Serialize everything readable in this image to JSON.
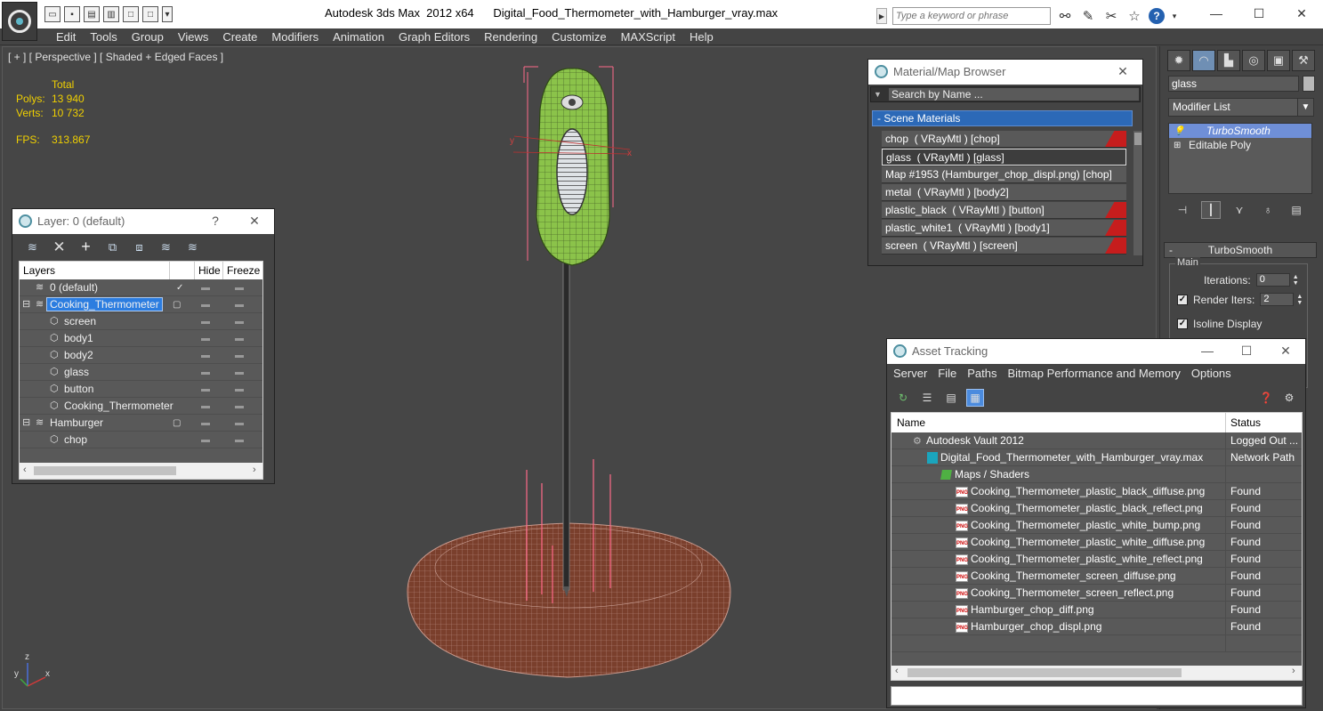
{
  "titlebar": {
    "app": "Autodesk 3ds Max  2012 x64",
    "file": "Digital_Food_Thermometer_with_Hamburger_vray.max",
    "search_placeholder": "Type a keyword or phrase",
    "minimize": "—",
    "maximize": "☐",
    "close": "✕"
  },
  "menus": [
    "Edit",
    "Tools",
    "Group",
    "Views",
    "Create",
    "Modifiers",
    "Animation",
    "Graph Editors",
    "Rendering",
    "Customize",
    "MAXScript",
    "Help"
  ],
  "viewport": {
    "label": "[ + ] [ Perspective ] [ Shaded + Edged Faces ]",
    "stats": {
      "total_label": "Total",
      "polys_label": "Polys:",
      "polys_value": "13 940",
      "verts_label": "Verts:",
      "verts_value": "10 732",
      "fps_label": "FPS:",
      "fps_value": "313.867"
    },
    "axis": {
      "x": "x",
      "y": "y",
      "z": "z"
    }
  },
  "layer_window": {
    "title": "Layer: 0 (default)",
    "help": "?",
    "close": "✕",
    "columns": {
      "layers": "Layers",
      "hide": "Hide",
      "freeze": "Freeze"
    },
    "rows": [
      {
        "name": "0 (default)",
        "level": 0,
        "kind": "layer",
        "active": true
      },
      {
        "name": "Cooking_Thermometer",
        "level": 0,
        "kind": "layer",
        "selected": true
      },
      {
        "name": "screen",
        "level": 1,
        "kind": "object"
      },
      {
        "name": "body1",
        "level": 1,
        "kind": "object"
      },
      {
        "name": "body2",
        "level": 1,
        "kind": "object"
      },
      {
        "name": "glass",
        "level": 1,
        "kind": "object"
      },
      {
        "name": "button",
        "level": 1,
        "kind": "object"
      },
      {
        "name": "Cooking_Thermometer",
        "level": 1,
        "kind": "object"
      },
      {
        "name": "Hamburger",
        "level": 0,
        "kind": "layer"
      },
      {
        "name": "chop",
        "level": 1,
        "kind": "object"
      }
    ]
  },
  "material_browser": {
    "title": "Material/Map Browser",
    "close": "✕",
    "search_placeholder": "Search by Name ...",
    "group_label": "- Scene Materials",
    "items": [
      {
        "label": "chop  ( VRayMtl ) [chop]",
        "swatch": true
      },
      {
        "label": "glass  ( VRayMtl ) [glass]",
        "swatch": false,
        "selected": true
      },
      {
        "label": "Map #1953 (Hamburger_chop_displ.png) [chop]",
        "swatch": false
      },
      {
        "label": "metal  ( VRayMtl ) [body2]",
        "swatch": false
      },
      {
        "label": "plastic_black  ( VRayMtl ) [button]",
        "swatch": true
      },
      {
        "label": "plastic_white1  ( VRayMtl ) [body1]",
        "swatch": true
      },
      {
        "label": "screen  ( VRayMtl ) [screen]",
        "swatch": true
      }
    ]
  },
  "command_panel": {
    "object_name": "glass",
    "modifier_list": "Modifier List",
    "stack": [
      {
        "label": "TurboSmooth",
        "selected": true
      },
      {
        "label": "Editable Poly",
        "selected": false
      }
    ],
    "rollout_title": "TurboSmooth",
    "rollout_group": "Main",
    "iterations_label": "Iterations:",
    "iterations_value": "0",
    "render_iters_label": "Render Iters:",
    "render_iters_value": "2",
    "isoline_label": "Isoline Display"
  },
  "asset_tracking": {
    "title": "Asset Tracking",
    "menu": [
      "Server",
      "File",
      "Paths",
      "Bitmap Performance and Memory",
      "Options"
    ],
    "columns": {
      "name": "Name",
      "status": "Status"
    },
    "rows": [
      {
        "name": "Autodesk Vault 2012",
        "status": "Logged Out ...",
        "indent": 1,
        "icon": "vault"
      },
      {
        "name": "Digital_Food_Thermometer_with_Hamburger_vray.max",
        "status": "Network Path",
        "indent": 2,
        "icon": "max"
      },
      {
        "name": "Maps / Shaders",
        "status": "",
        "indent": 3,
        "icon": "maps"
      },
      {
        "name": "Cooking_Thermometer_plastic_black_diffuse.png",
        "status": "Found",
        "indent": 4,
        "icon": "png"
      },
      {
        "name": "Cooking_Thermometer_plastic_black_reflect.png",
        "status": "Found",
        "indent": 4,
        "icon": "png"
      },
      {
        "name": "Cooking_Thermometer_plastic_white_bump.png",
        "status": "Found",
        "indent": 4,
        "icon": "png"
      },
      {
        "name": "Cooking_Thermometer_plastic_white_diffuse.png",
        "status": "Found",
        "indent": 4,
        "icon": "png"
      },
      {
        "name": "Cooking_Thermometer_plastic_white_reflect.png",
        "status": "Found",
        "indent": 4,
        "icon": "png"
      },
      {
        "name": "Cooking_Thermometer_screen_diffuse.png",
        "status": "Found",
        "indent": 4,
        "icon": "png"
      },
      {
        "name": "Cooking_Thermometer_screen_reflect.png",
        "status": "Found",
        "indent": 4,
        "icon": "png"
      },
      {
        "name": "Hamburger_chop_diff.png",
        "status": "Found",
        "indent": 4,
        "icon": "png"
      },
      {
        "name": "Hamburger_chop_displ.png",
        "status": "Found",
        "indent": 4,
        "icon": "png"
      }
    ]
  },
  "colors": {
    "stats_text": "#f0d000",
    "selection_blue": "#2c7de0",
    "material_swatch_red": "#c61d1d",
    "thermometer_green": "#8bc34a",
    "burger_brown": "#7a3f2c"
  }
}
